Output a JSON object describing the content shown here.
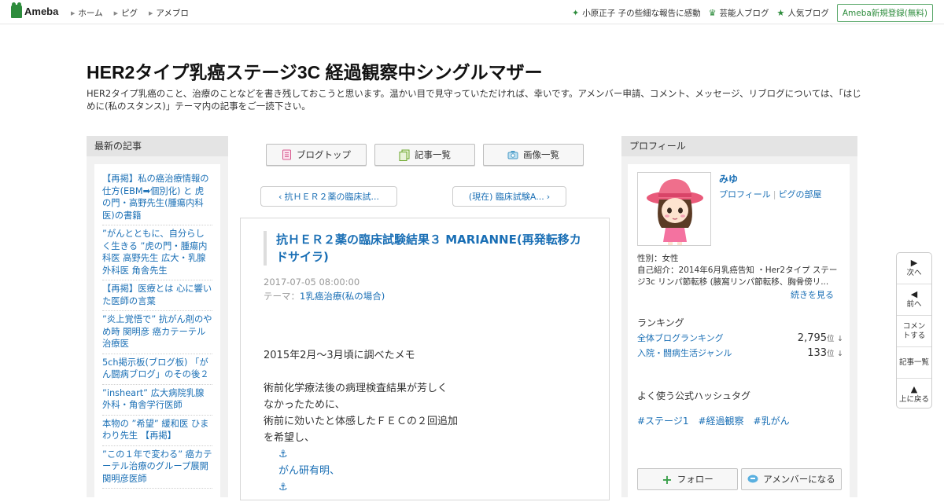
{
  "header": {
    "logo_text": "Ameba",
    "nav": [
      "ホーム",
      "ピグ",
      "アメブロ"
    ],
    "right_items": [
      {
        "icon": "green-sparkle-icon",
        "label": "小原正子 子の些細な報告に感動"
      },
      {
        "icon": "crown-icon",
        "label": "芸能人ブログ"
      },
      {
        "icon": "star-icon",
        "label": "人気ブログ"
      }
    ],
    "signup": "Ameba新規登録(無料)"
  },
  "blog": {
    "title": "HER2タイプ乳癌ステージ3C 経過観察中シングルマザー",
    "description": "HER2タイプ乳癌のこと、治療のことなどを書き残しておこうと思います。温かい目で見守っていただければ、幸いです。アメンバー申請、コメント、メッセージ、リブログについては、「はじめに(私のスタンス)」テーマ内の記事をご一読下さい。"
  },
  "recent": {
    "heading": "最新の記事",
    "entries": [
      "【再掲】私の癌治療情報の仕方(EBM➡個別化) と 虎の門・高野先生(腫瘍内科医)の書籍",
      "”がんとともに、自分らしく生きる ”虎の門・腫瘍内科医 高野先生 広大・乳腺外科医 角舎先生",
      "【再掲】医療とは 心に響いた医師の言葉",
      "”炎上覚悟で” 抗がん剤のやめ時 関明彦 癌カテーテル治療医",
      "5ch掲示板(ブログ板) 「がん闘病ブログ」のその後２",
      "”insheart” 広大病院乳腺外科・角舎学行医師",
      "本物の ”希望” 緩和医 ひまわり先生 【再掲】",
      "”この１年で変わる” 癌カテーテル治療のグループ展開 関明彦医師"
    ]
  },
  "center": {
    "buttons": [
      {
        "icon": "notebook-icon",
        "label": "ブログトップ"
      },
      {
        "icon": "list-icon",
        "label": "記事一覧"
      },
      {
        "icon": "camera-icon",
        "label": "画像一覧"
      }
    ],
    "prev_link": "抗ＨＥＲ２薬の臨床試...",
    "next_link": "(現在) 臨床試験A...",
    "article": {
      "title": "抗ＨＥＲ２薬の臨床試験結果３ MARIANNE(再発転移カドサイラ)",
      "date": "2017-07-05 08:00:00",
      "theme_label": "テーマ：",
      "theme": "1乳癌治療(私の場合)",
      "body": [
        "2015年2月～3月頃に調べたメモ",
        "",
        "術前化学療法後の病理検査結果が芳しく",
        "なかったために、",
        "術前に効いたと体感したＦＥＣの２回追加",
        "を希望し、"
      ],
      "indent_lines": [
        "⚓",
        "がん研有明、",
        "⚓"
      ]
    }
  },
  "profile": {
    "heading": "プロフィール",
    "name": "みゆ",
    "link_profile": "プロフィール",
    "link_room": "ピグの部屋",
    "gender": "性別：女性",
    "intro": "自己紹介：2014年6月乳癌告知 ・Her2タイプ ステージ3c リンパ節転移 (腋窩リンパ節転移、胸骨傍リ...",
    "more": "続きを見る",
    "ranking_heading": "ランキング",
    "rankings": [
      {
        "label": "全体ブログランキング",
        "value": "2,795",
        "unit": "位",
        "arrow": "↓"
      },
      {
        "label": "入院・闘病生活ジャンル",
        "value": "133",
        "unit": "位",
        "arrow": "↓"
      }
    ],
    "hashtag_heading": "よく使う公式ハッシュタグ",
    "hashtags": [
      "#ステージ1",
      "#経過観察",
      "#乳がん"
    ],
    "follow": "フォロー",
    "amember": "アメンバーになる"
  },
  "sidenav": [
    {
      "icon": "▶",
      "label": "次へ"
    },
    {
      "icon": "◀",
      "label": "前へ"
    },
    {
      "icon": "",
      "label": "コメントする"
    },
    {
      "icon": "",
      "label": "記事一覧"
    },
    {
      "icon": "▲",
      "label": "上に戻る"
    }
  ],
  "colors": {
    "brand": "#2d8c3c",
    "link": "#1a6fb5"
  }
}
